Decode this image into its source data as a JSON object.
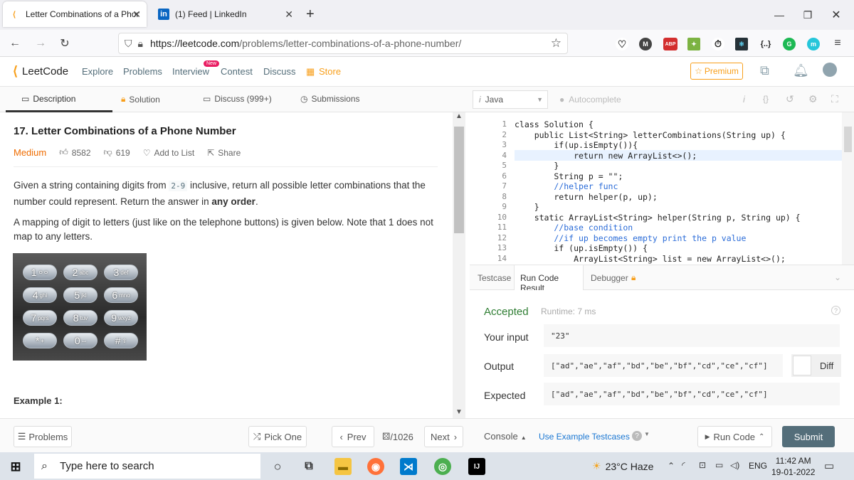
{
  "browser": {
    "tabs": [
      {
        "title": "Letter Combinations of a Phone",
        "active": true,
        "icon": "leetcode-icon"
      },
      {
        "title": "(1) Feed | LinkedIn",
        "active": false,
        "icon": "linkedin-icon"
      }
    ],
    "new_tab": "+",
    "url_host": "https://leetcode.com",
    "url_path": "/problems/letter-combinations-of-a-phone-number/",
    "extensions": [
      "pocket-icon",
      "M",
      "ABP",
      "extension-icon",
      "timer-icon",
      "react-icon",
      "{..}",
      "G",
      "m"
    ]
  },
  "header": {
    "brand": "LeetCode",
    "nav": [
      "Explore",
      "Problems",
      "Interview",
      "Contest",
      "Discuss",
      "Store"
    ],
    "new_badge": "New",
    "premium": "Premium"
  },
  "left_tabs": [
    "Description",
    "Solution",
    "Discuss (999+)",
    "Submissions"
  ],
  "problem": {
    "title": "17. Letter Combinations of a Phone Number",
    "difficulty": "Medium",
    "likes": "8582",
    "dislikes": "619",
    "add_to_list": "Add to List",
    "share": "Share",
    "p1_a": "Given a string containing digits from ",
    "p1_code": "2-9",
    "p1_b": " inclusive, return all possible letter combinations that the number could represent. Return the answer in ",
    "p1_bold": "any order",
    "p1_c": ".",
    "p2": "A mapping of digit to letters (just like on the telephone buttons) is given below. Note that 1 does not map to any letters.",
    "keypad": [
      [
        "1",
        "ㅇㅇ"
      ],
      [
        "2",
        "abc"
      ],
      [
        "3",
        "def"
      ],
      [
        "4",
        "ghi"
      ],
      [
        "5",
        "jkl"
      ],
      [
        "6",
        "mno"
      ],
      [
        "7",
        "pqrs"
      ],
      [
        "8",
        "tuv"
      ],
      [
        "9",
        "wxyz"
      ],
      [
        "*",
        "+"
      ],
      [
        "0",
        "⌴"
      ],
      [
        "#",
        "⇧"
      ]
    ],
    "example_heading": "Example 1:"
  },
  "editor": {
    "language": "Java",
    "autocomplete": "Autocomplete",
    "line_numbers": [
      "1",
      "2",
      "3",
      "4",
      "5",
      "6",
      "7",
      "8",
      "9",
      "10",
      "11",
      "12",
      "13",
      "14"
    ],
    "lines": [
      "class Solution {",
      "    public List<String> letterCombinations(String up) {",
      "        if(up.isEmpty()){",
      "            return new ArrayList<>();",
      "        }",
      "        String p = \"\";",
      "        //helper func",
      "        return helper(p, up);",
      "    }",
      "    static ArrayList<String> helper(String p, String up) {",
      "        //base condition",
      "        //if up becomes empty print the p value",
      "        if (up.isEmpty()) {",
      "            ArrayList<String> list = new ArrayList<>();"
    ]
  },
  "result_tabs": [
    "Testcase",
    "Run Code Result",
    "Debugger"
  ],
  "result": {
    "status": "Accepted",
    "runtime": "Runtime: 7 ms",
    "input_label": "Your input",
    "input": "\"23\"",
    "output_label": "Output",
    "output": "[\"ad\",\"ae\",\"af\",\"bd\",\"be\",\"bf\",\"cd\",\"ce\",\"cf\"]",
    "expected_label": "Expected",
    "expected": "[\"ad\",\"ae\",\"af\",\"bd\",\"be\",\"bf\",\"cd\",\"ce\",\"cf\"]",
    "diff": "Diff"
  },
  "bottom": {
    "problems": "Problems",
    "pick_one": "Pick One",
    "prev": "Prev",
    "page": "/1026",
    "next": "Next",
    "console": "Console",
    "use_example": "Use Example Testcases",
    "run_code": "Run Code",
    "submit": "Submit"
  },
  "taskbar": {
    "search": "Type here to search",
    "weather": "23°C  Haze",
    "lang": "ENG",
    "time": "11:42 AM",
    "date": "19-01-2022"
  },
  "colors": {
    "medium": "#ef6c00",
    "accepted": "#2e7d32",
    "submit": "#546e7a",
    "link": "#1976d2",
    "brand_orange": "#f89f1b"
  }
}
